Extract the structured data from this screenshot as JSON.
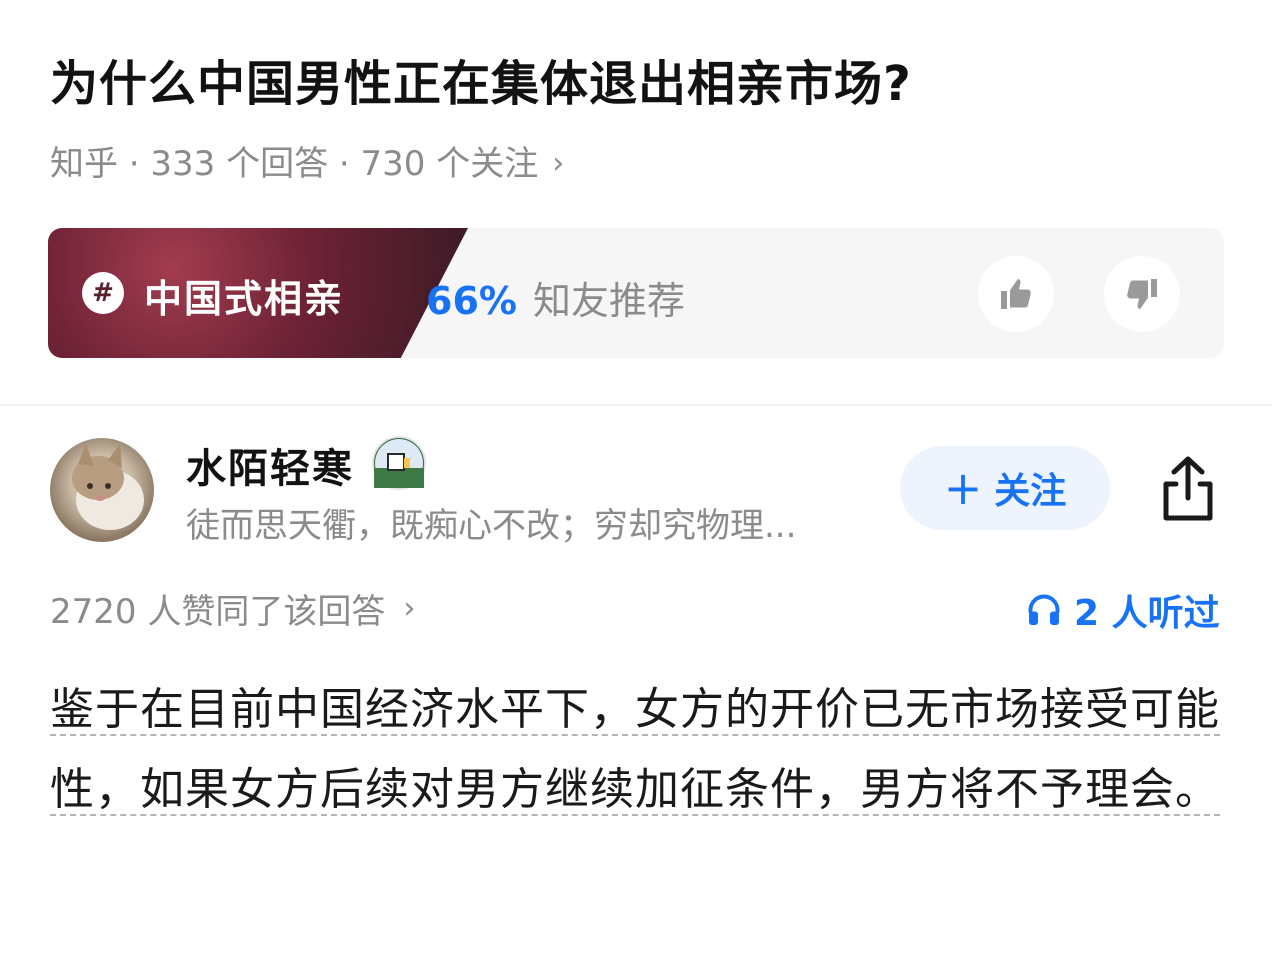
{
  "question": {
    "title": "为什么中国男性正在集体退出相亲市场?",
    "meta": "知乎 · 333 个回答 · 730 个关注",
    "meta_chevron": "›"
  },
  "topic": {
    "hash": "#",
    "label": "中国式相亲",
    "recommend_pct": "66%",
    "recommend_text": "知友推荐"
  },
  "author": {
    "name": "水陌轻寒",
    "bio": "徒而思天衢，既痴心不改；穷却究物理...",
    "follow_plus": "+",
    "follow_label": "关注"
  },
  "stats": {
    "upvotes": "2720 人赞同了该回答",
    "upvotes_chevron": "›",
    "listened": "2 人听过"
  },
  "answer": {
    "text": "鉴于在目前中国经济水平下，女方的开价已无市场接受可能性，如果女方后续对男方继续加征条件，男方将不予理会。"
  },
  "colors": {
    "accent": "#1772f6",
    "muted": "#8b8b8b",
    "topic_bg": "#6d2235"
  },
  "icons": [
    "thumbs-up-icon",
    "thumbs-down-icon",
    "share-icon",
    "headphones-icon",
    "hash-icon",
    "badge-icon"
  ]
}
